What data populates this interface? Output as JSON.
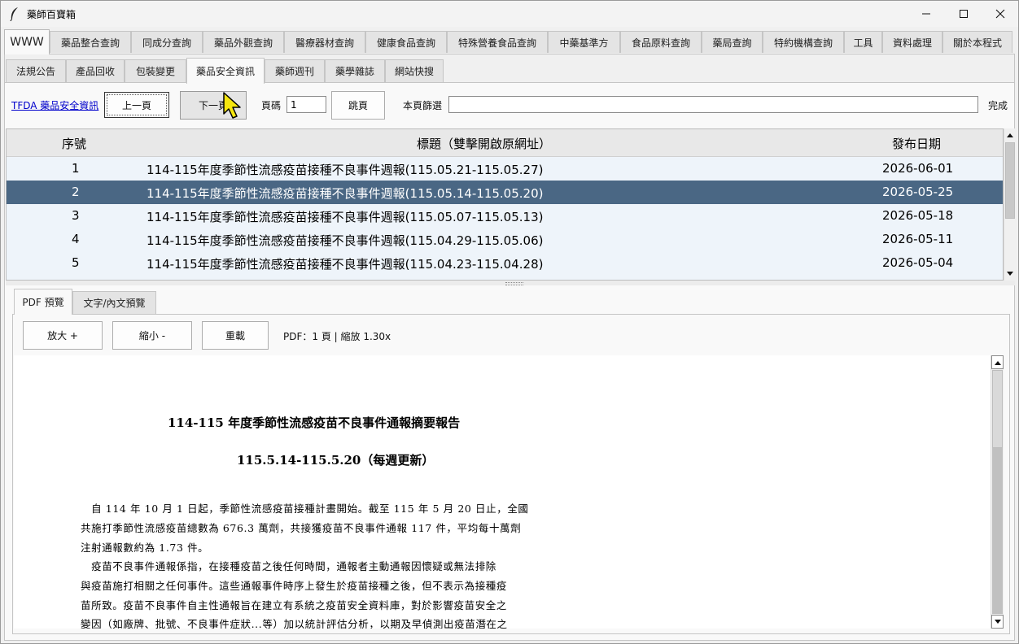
{
  "window": {
    "title": "藥師百寶箱",
    "icon": "feather-icon",
    "controls": [
      "minimize-icon",
      "maximize-icon",
      "close-icon"
    ]
  },
  "main_tabs": [
    {
      "label": "WWW",
      "active": true
    },
    {
      "label": "藥品整合查詢"
    },
    {
      "label": "同成分查詢"
    },
    {
      "label": "藥品外觀查詢"
    },
    {
      "label": "醫療器材查詢"
    },
    {
      "label": "健康食品查詢"
    },
    {
      "label": "特殊營養食品查詢"
    },
    {
      "label": "中藥基準方"
    },
    {
      "label": "食品原料查詢"
    },
    {
      "label": "藥局查詢"
    },
    {
      "label": "特約機構查詢"
    },
    {
      "label": "工具"
    },
    {
      "label": "資料處理"
    },
    {
      "label": "關於本程式"
    }
  ],
  "sub_tabs": [
    {
      "label": "法規公告"
    },
    {
      "label": "產品回收"
    },
    {
      "label": "包裝變更"
    },
    {
      "label": "藥品安全資訊",
      "active": true
    },
    {
      "label": "藥師週刊"
    },
    {
      "label": "藥學雜誌"
    },
    {
      "label": "網站快搜"
    }
  ],
  "toolbar": {
    "source_link": "TFDA 藥品安全資訊",
    "prev_label": "上一頁",
    "next_label": "下一頁",
    "page_label": "頁碼",
    "page_value": "1",
    "jump_label": "跳頁",
    "filter_label": "本頁篩選",
    "filter_value": "",
    "status": "完成"
  },
  "table": {
    "columns": [
      "序號",
      "標題（雙擊開啟原網址）",
      "發布日期"
    ],
    "rows": [
      {
        "no": "1",
        "title": "114-115年度季節性流感疫苗接種不良事件週報(115.05.21-115.05.27)",
        "date": "2026-06-01"
      },
      {
        "no": "2",
        "title": "114-115年度季節性流感疫苗接種不良事件週報(115.05.14-115.05.20)",
        "date": "2026-05-25",
        "selected": true
      },
      {
        "no": "3",
        "title": "114-115年度季節性流感疫苗接種不良事件週報(115.05.07-115.05.13)",
        "date": "2026-05-18"
      },
      {
        "no": "4",
        "title": "114-115年度季節性流感疫苗接種不良事件週報(115.04.29-115.05.06)",
        "date": "2026-05-11"
      },
      {
        "no": "5",
        "title": "114-115年度季節性流感疫苗接種不良事件週報(115.04.23-115.04.28)",
        "date": "2026-05-04"
      }
    ]
  },
  "preview_tabs": [
    {
      "label": "PDF 預覽",
      "active": true
    },
    {
      "label": "文字/內文預覽"
    }
  ],
  "pdf_toolbar": {
    "zoom_in": "放大 +",
    "zoom_out": "縮小 -",
    "reload": "重載",
    "info": "PDF：1 頁 | 縮放 1.30x"
  },
  "pdf_content": {
    "title": "114-115 年度季節性流感疫苗不良事件通報摘要報告",
    "subtitle": "115.5.14-115.5.20（每週更新）",
    "lines": [
      "　自 114 年 10 月 1 日起，季節性流感疫苗接種計畫開始。截至 115 年 5 月 20 日止，全國",
      "共施打季節性流感疫苗總數為 676.3 萬劑，共接獲疫苗不良事件通報 117 件，平均每十萬劑",
      "注射通報數約為 1.73 件。",
      "　疫苗不良事件通報係指，在接種疫苗之後任何時間，通報者主動通報因懷疑或無法排除",
      "與疫苗施打相關之任何事件。這些通報事件時序上發生於疫苗接種之後，但不表示為接種疫",
      "苗所致。疫苗不良事件自主性通報旨在建立有系統之疫苗安全資料庫，對於影響疫苗安全之",
      "變因（如廠牌、批號、不良事件症狀...等）加以統計評估分析，以期及早偵測出疫苗潛在之"
    ]
  }
}
